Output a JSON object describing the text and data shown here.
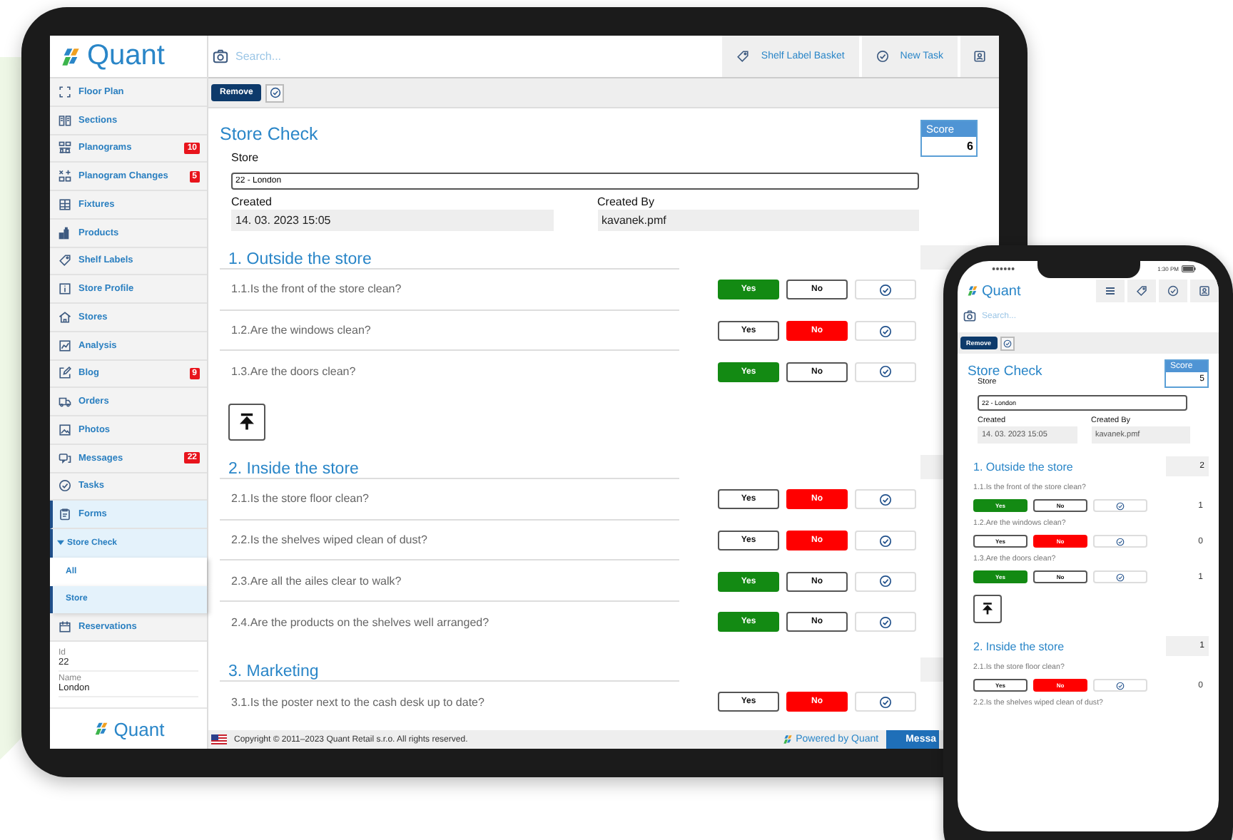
{
  "tablet": {
    "logo": "Quant",
    "search": {
      "placeholder": "Search..."
    },
    "header_buttons": [
      {
        "label": "Shelf Label Basket"
      },
      {
        "label": "New Task"
      }
    ],
    "toolbar": {
      "remove": "Remove"
    },
    "sidebar": {
      "items": [
        {
          "label": "Floor Plan",
          "selected": false
        },
        {
          "label": "Sections",
          "selected": false
        },
        {
          "label": "Planograms",
          "badge": "10",
          "selected": false
        },
        {
          "label": "Planogram Changes",
          "badge": "5",
          "selected": false
        },
        {
          "label": "Fixtures",
          "selected": false
        },
        {
          "label": "Products",
          "selected": false
        },
        {
          "label": "Shelf Labels",
          "selected": false
        },
        {
          "label": "Store Profile",
          "selected": false
        },
        {
          "label": "Stores",
          "selected": false
        },
        {
          "label": "Analysis",
          "selected": false
        },
        {
          "label": "Blog",
          "badge": "9",
          "selected": false
        },
        {
          "label": "Orders",
          "selected": false
        },
        {
          "label": "Photos",
          "selected": false
        },
        {
          "label": "Messages",
          "badge": "22",
          "selected": false
        },
        {
          "label": "Tasks",
          "selected": false
        },
        {
          "label": "Forms",
          "selected": true,
          "children": [
            {
              "label": "Store Check",
              "expanded": true,
              "children": [
                {
                  "label": "All",
                  "selected": false
                },
                {
                  "label": "Store",
                  "selected": true
                }
              ]
            }
          ]
        },
        {
          "label": "Reservations",
          "selected": false
        }
      ]
    },
    "details": [
      {
        "label": "Id",
        "value": "22"
      },
      {
        "label": "Name",
        "value": "London"
      }
    ],
    "bottom_logo": "Quant",
    "form": {
      "title": "Store Check",
      "score_label": "Score",
      "score": "6",
      "store_label": "Store",
      "store_value": "22 - London",
      "created_label": "Created",
      "created_value": "14. 03. 2023 15:05",
      "created_by_label": "Created By",
      "created_by_value": "kavanek.pmf",
      "sections": [
        {
          "title": "1. Outside the store",
          "back_to_top": true,
          "questions": [
            {
              "text": "1.1.Is the front of the store clean?",
              "options": [
                {
                  "kind": "yes",
                  "label": "Yes",
                  "selected": true
                },
                {
                  "kind": "no",
                  "label": "No",
                  "selected": false
                }
              ]
            },
            {
              "text": "1.2.Are the windows clean?",
              "options": [
                {
                  "kind": "yes",
                  "label": "Yes",
                  "selected": false
                },
                {
                  "kind": "no",
                  "label": "No",
                  "selected": true
                }
              ]
            },
            {
              "text": "1.3.Are the doors clean?",
              "options": [
                {
                  "kind": "yes",
                  "label": "Yes",
                  "selected": true
                },
                {
                  "kind": "no",
                  "label": "No",
                  "selected": false
                }
              ]
            }
          ]
        },
        {
          "title": "2. Inside the store",
          "back_to_top": false,
          "questions": [
            {
              "text": "2.1.Is the store floor clean?",
              "options": [
                {
                  "kind": "yes",
                  "label": "Yes",
                  "selected": false
                },
                {
                  "kind": "no",
                  "label": "No",
                  "selected": true
                }
              ]
            },
            {
              "text": "2.2.Is the shelves wiped clean of dust?",
              "options": [
                {
                  "kind": "yes",
                  "label": "Yes",
                  "selected": false
                },
                {
                  "kind": "no",
                  "label": "No",
                  "selected": true
                }
              ]
            },
            {
              "text": "2.3.Are all the ailes clear to walk?",
              "options": [
                {
                  "kind": "yes",
                  "label": "Yes",
                  "selected": true
                },
                {
                  "kind": "no",
                  "label": "No",
                  "selected": false
                }
              ]
            },
            {
              "text": "2.4.Are the products on the shelves well arranged?",
              "options": [
                {
                  "kind": "yes",
                  "label": "Yes",
                  "selected": true
                },
                {
                  "kind": "no",
                  "label": "No",
                  "selected": false
                }
              ]
            }
          ]
        },
        {
          "title": "3. Marketing",
          "back_to_top": false,
          "questions": [
            {
              "text": "3.1.Is the poster next to the cash desk up to date?",
              "options": [
                {
                  "kind": "yes",
                  "label": "Yes",
                  "selected": false
                },
                {
                  "kind": "no",
                  "label": "No",
                  "selected": true
                }
              ]
            }
          ]
        }
      ]
    },
    "footer": {
      "copyright": "Copyright © 2011–2023 Quant Retail s.r.o. All rights reserved.",
      "powered_by": "Powered by Quant",
      "messages_tab": "Messa"
    }
  },
  "phone": {
    "status_time": "1:30 PM",
    "logo": "Quant",
    "search": {
      "placeholder": "Search..."
    },
    "toolbar": {
      "remove": "Remove"
    },
    "form": {
      "title": "Store Check",
      "score_label": "Score",
      "score": "5",
      "store_label": "Store",
      "store_value": "22 - London",
      "created_label": "Created",
      "created_value": "14. 03. 2023 15:05",
      "created_by_label": "Created By",
      "created_by_value": "kavanek.pmf",
      "sections": [
        {
          "title": "1. Outside the store",
          "score": "2",
          "back_to_top": true,
          "questions": [
            {
              "text": "1.1.Is the front of the store clean?",
              "points": "1",
              "options": [
                {
                  "kind": "yes",
                  "label": "Yes",
                  "selected": true
                },
                {
                  "kind": "no",
                  "label": "No",
                  "selected": false
                }
              ]
            },
            {
              "text": "1.2.Are the windows clean?",
              "points": "0",
              "options": [
                {
                  "kind": "yes",
                  "label": "Yes",
                  "selected": false
                },
                {
                  "kind": "no",
                  "label": "No",
                  "selected": true
                }
              ]
            },
            {
              "text": "1.3.Are the doors clean?",
              "points": "1",
              "options": [
                {
                  "kind": "yes",
                  "label": "Yes",
                  "selected": true
                },
                {
                  "kind": "no",
                  "label": "No",
                  "selected": false
                }
              ]
            }
          ]
        },
        {
          "title": "2. Inside the store",
          "score": "1",
          "back_to_top": false,
          "questions": [
            {
              "text": "2.1.Is the store floor clean?",
              "points": "0",
              "options": [
                {
                  "kind": "yes",
                  "label": "Yes",
                  "selected": false
                },
                {
                  "kind": "no",
                  "label": "No",
                  "selected": true
                }
              ]
            },
            {
              "text": "2.2.Is the shelves wiped clean of dust?"
            }
          ]
        }
      ]
    }
  }
}
